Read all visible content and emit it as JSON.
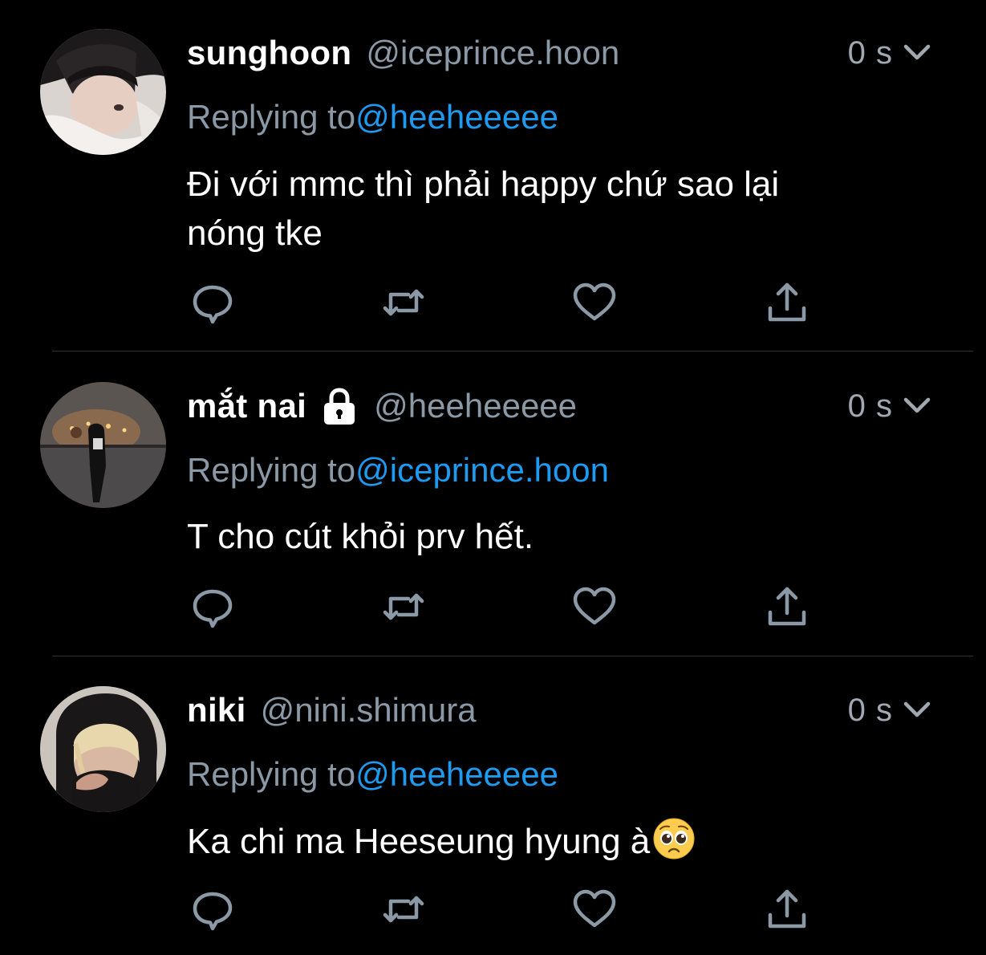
{
  "tweets": [
    {
      "display_name": "sunghoon",
      "handle": "@iceprince.hoon",
      "time": "0 s",
      "reply_prefix": "Replying to",
      "reply_mention": "@heeheeeee",
      "text_line1": "Đi với mmc thì phải happy chứ sao lại",
      "text_line2": "nóng tke",
      "locked": false,
      "avatar_icon": "avatar-photo"
    },
    {
      "display_name": "mắt nai",
      "handle": "@heeheeeee",
      "time": "0 s",
      "reply_prefix": "Replying to",
      "reply_mention": "@iceprince.hoon",
      "text_line1": "T cho cút khỏi prv hết.",
      "locked": true,
      "lock_icon": "lock-icon",
      "avatar_icon": "avatar-photo"
    },
    {
      "display_name": "niki",
      "handle": "@nini.shimura",
      "time": "0 s",
      "reply_prefix": "Replying to",
      "reply_mention": "@heeheeeee",
      "text_line1": "Ka chi ma Heeseung hyung à",
      "emoji": "pleading-face-emoji",
      "locked": false,
      "avatar_icon": "avatar-photo"
    }
  ],
  "actions": {
    "reply": "reply-icon",
    "retweet": "retweet-icon",
    "like": "heart-icon",
    "share": "share-icon"
  },
  "colors": {
    "background": "#000000",
    "text": "#ffffff",
    "secondary": "#8b98a5",
    "link": "#1d9bf0",
    "divider": "#2f3336"
  }
}
